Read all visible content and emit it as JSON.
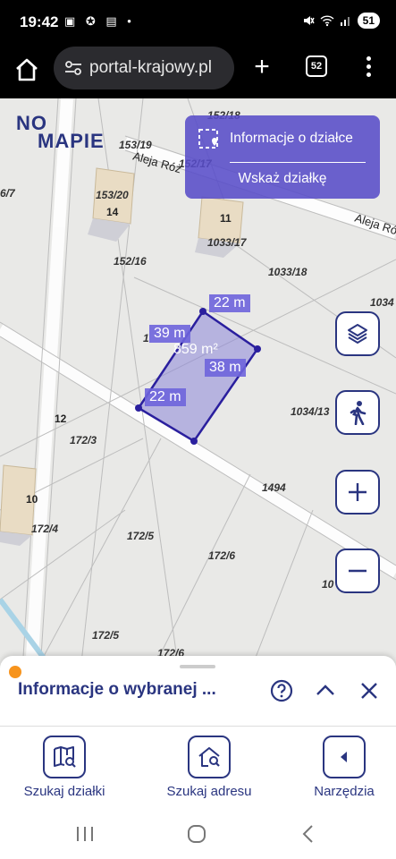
{
  "status_bar": {
    "time": "19:42",
    "left_icons": "▣ ✪ ▤ •",
    "battery": "51"
  },
  "browser": {
    "url": "portal-krajowy.pl",
    "tab_count": "52"
  },
  "map": {
    "logo_line1": "NO",
    "logo_line2": "MAPIE",
    "info_panel": {
      "parcel_info_label": "Informacje o działce",
      "point_parcel_label": "Wskaż działkę"
    },
    "parcel_measurements": {
      "top": "22 m",
      "left": "39 m",
      "area": "859 m²",
      "right": "38 m",
      "bottom": "22 m"
    },
    "parcel_labels": [
      "152/18",
      "153/19",
      "152/17",
      "6/7",
      "153/20",
      "152/16",
      "1033/17",
      "1033/18",
      "1034",
      "1034/13",
      "172/3",
      "1494",
      "172/4",
      "172/5",
      "172/6",
      "10",
      "172/5",
      "172/6",
      "1"
    ],
    "house_numbers": [
      "14",
      "11",
      "12",
      "10"
    ],
    "streets": [
      "Aleja Róż",
      "Aleja Róż"
    ]
  },
  "bottom_sheet": {
    "title": "Informacje o wybranej ..."
  },
  "bottom_nav": {
    "search_parcel": "Szukaj działki",
    "search_address": "Szukaj adresu",
    "tools": "Narzędzia"
  },
  "colors": {
    "brand": "#2a3580",
    "accent": "#f7941d",
    "parcel_fill": "#8c86d9",
    "panel": "#584cc8"
  }
}
